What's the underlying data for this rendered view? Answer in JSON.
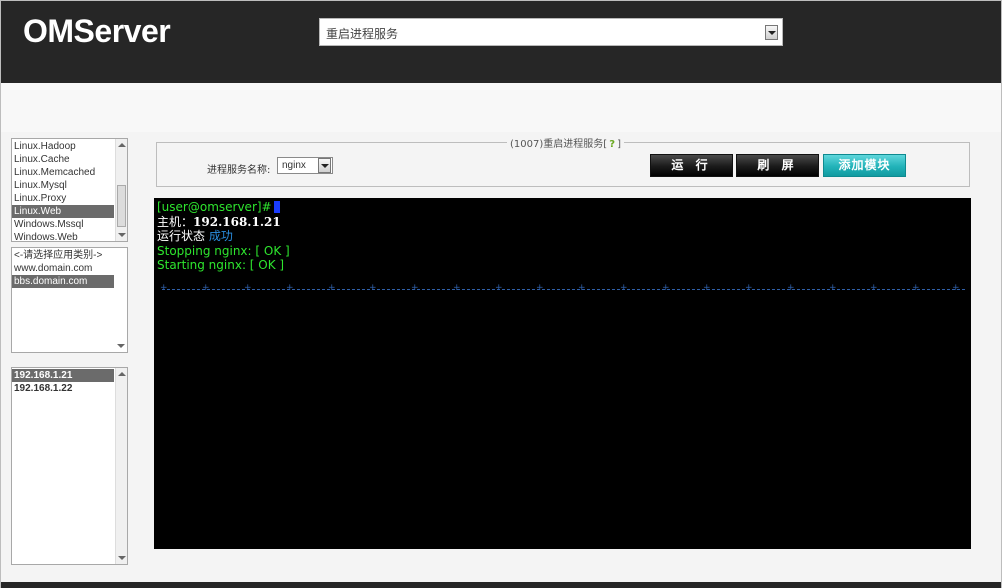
{
  "header": {
    "logo": "OMServer",
    "top_select_value": "重启进程服务"
  },
  "category_list": {
    "items": [
      "Linux.Hadoop",
      "Linux.Cache",
      "Linux.Memcached",
      "Linux.Mysql",
      "Linux.Proxy",
      "Linux.Web",
      "Windows.Mssql",
      "Windows.Web"
    ],
    "selected": "Linux.Web"
  },
  "app_list": {
    "items": [
      "<-请选择应用类别->",
      "www.domain.com",
      "bbs.domain.com"
    ],
    "selected": "bbs.domain.com"
  },
  "host_list": {
    "items": [
      "192.168.1.21",
      "192.168.1.22"
    ],
    "selected": "192.168.1.21"
  },
  "panel": {
    "legend": "(1007)重启进程服务[",
    "legend_end": "]",
    "help_icon": "?",
    "service_label": "进程服务名称:",
    "service_value": "nginx",
    "run_button": "运 行",
    "refresh_button": "刷 屏",
    "add_module_button": "添加模块"
  },
  "terminal": {
    "prompt": "[user@omserver]#",
    "host_label": "主机：",
    "host_value": "192.168.1.21",
    "status_label": "运行状态 ",
    "status_value": "成功",
    "line_stopping": "Stopping nginx: [ OK ]",
    "line_starting": "Starting nginx: [ OK ]"
  },
  "colors": {
    "header_bg": "#262626",
    "terminal_bg": "#000000",
    "terminal_green": "#2ee52e",
    "terminal_blue": "#2a8ee0",
    "accent_teal": "#22b3b9"
  }
}
